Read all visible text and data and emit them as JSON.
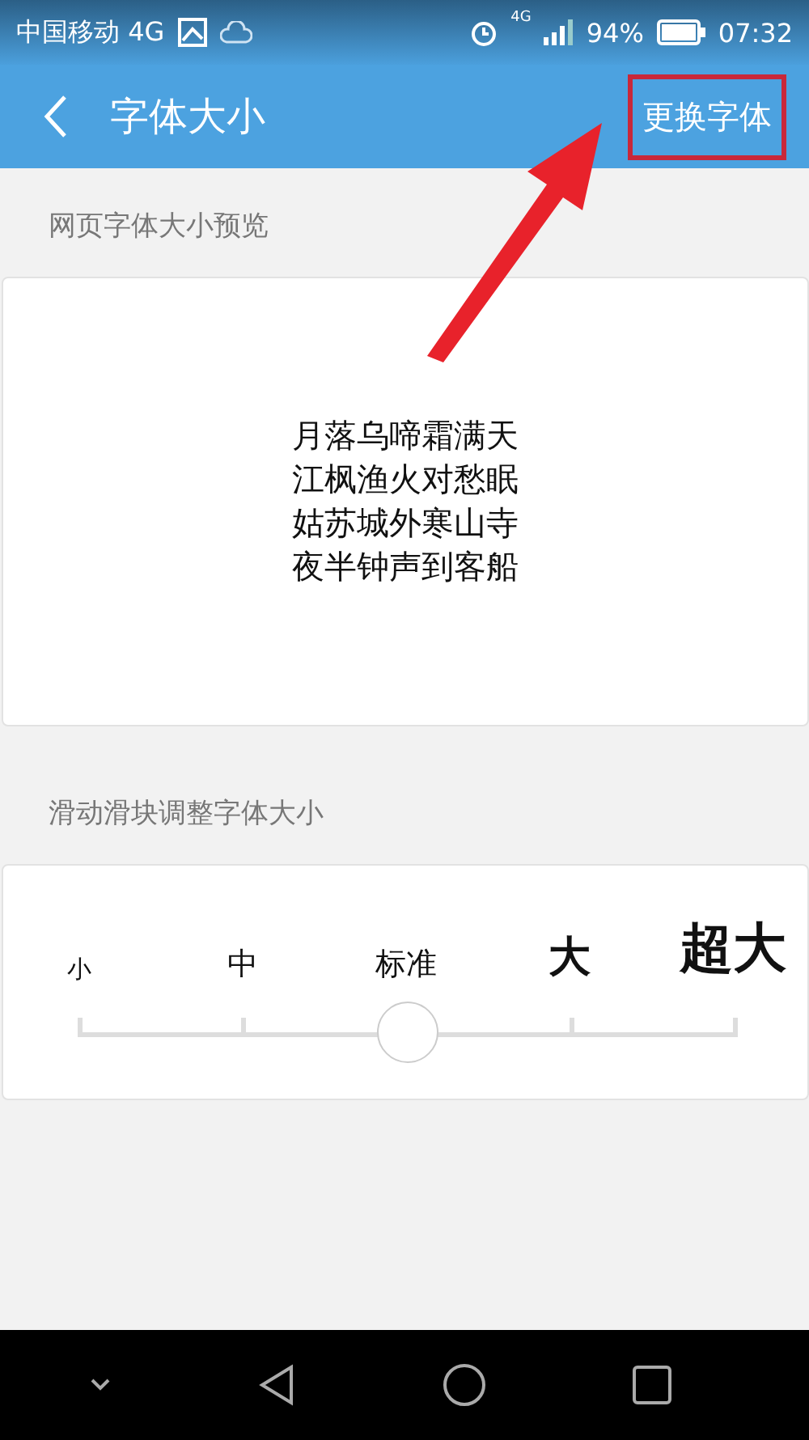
{
  "status_bar": {
    "carrier": "中国移动 4G",
    "network": "4G",
    "battery": "94%",
    "time": "07:32"
  },
  "app_bar": {
    "title": "字体大小",
    "action": "更换字体"
  },
  "preview": {
    "label": "网页字体大小预览",
    "lines": [
      "月落乌啼霜满天",
      "江枫渔火对愁眠",
      "姑苏城外寒山寺",
      "夜半钟声到客船"
    ]
  },
  "slider": {
    "label": "滑动滑块调整字体大小",
    "level": 0.5,
    "stops": [
      "小",
      "中",
      "标准",
      "大",
      "超大"
    ]
  }
}
